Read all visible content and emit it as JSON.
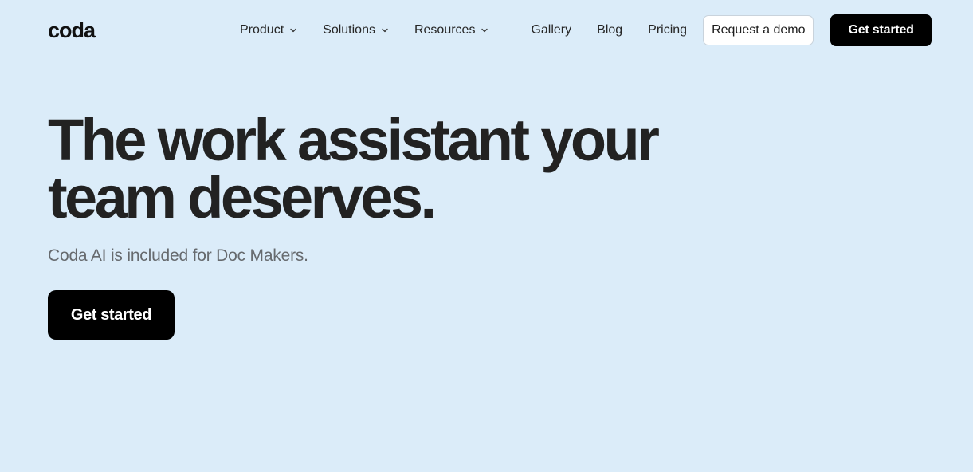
{
  "header": {
    "logo": "coda",
    "nav": {
      "product": "Product",
      "solutions": "Solutions",
      "resources": "Resources",
      "gallery": "Gallery",
      "blog": "Blog",
      "pricing": "Pricing"
    },
    "request_demo_label": "Request a demo",
    "get_started_label": "Get started"
  },
  "hero": {
    "headline_line1": "The work assistant your",
    "headline_line2": "team deserves.",
    "subtext": "Coda AI is included for Doc Makers.",
    "cta_label": "Get started"
  },
  "icons": {
    "dropdown": "chevron-down-icon"
  },
  "colors": {
    "background": "#dbecf9",
    "primary_button": "#000000",
    "primary_button_text": "#ffffff",
    "secondary_button": "#ffffff"
  }
}
